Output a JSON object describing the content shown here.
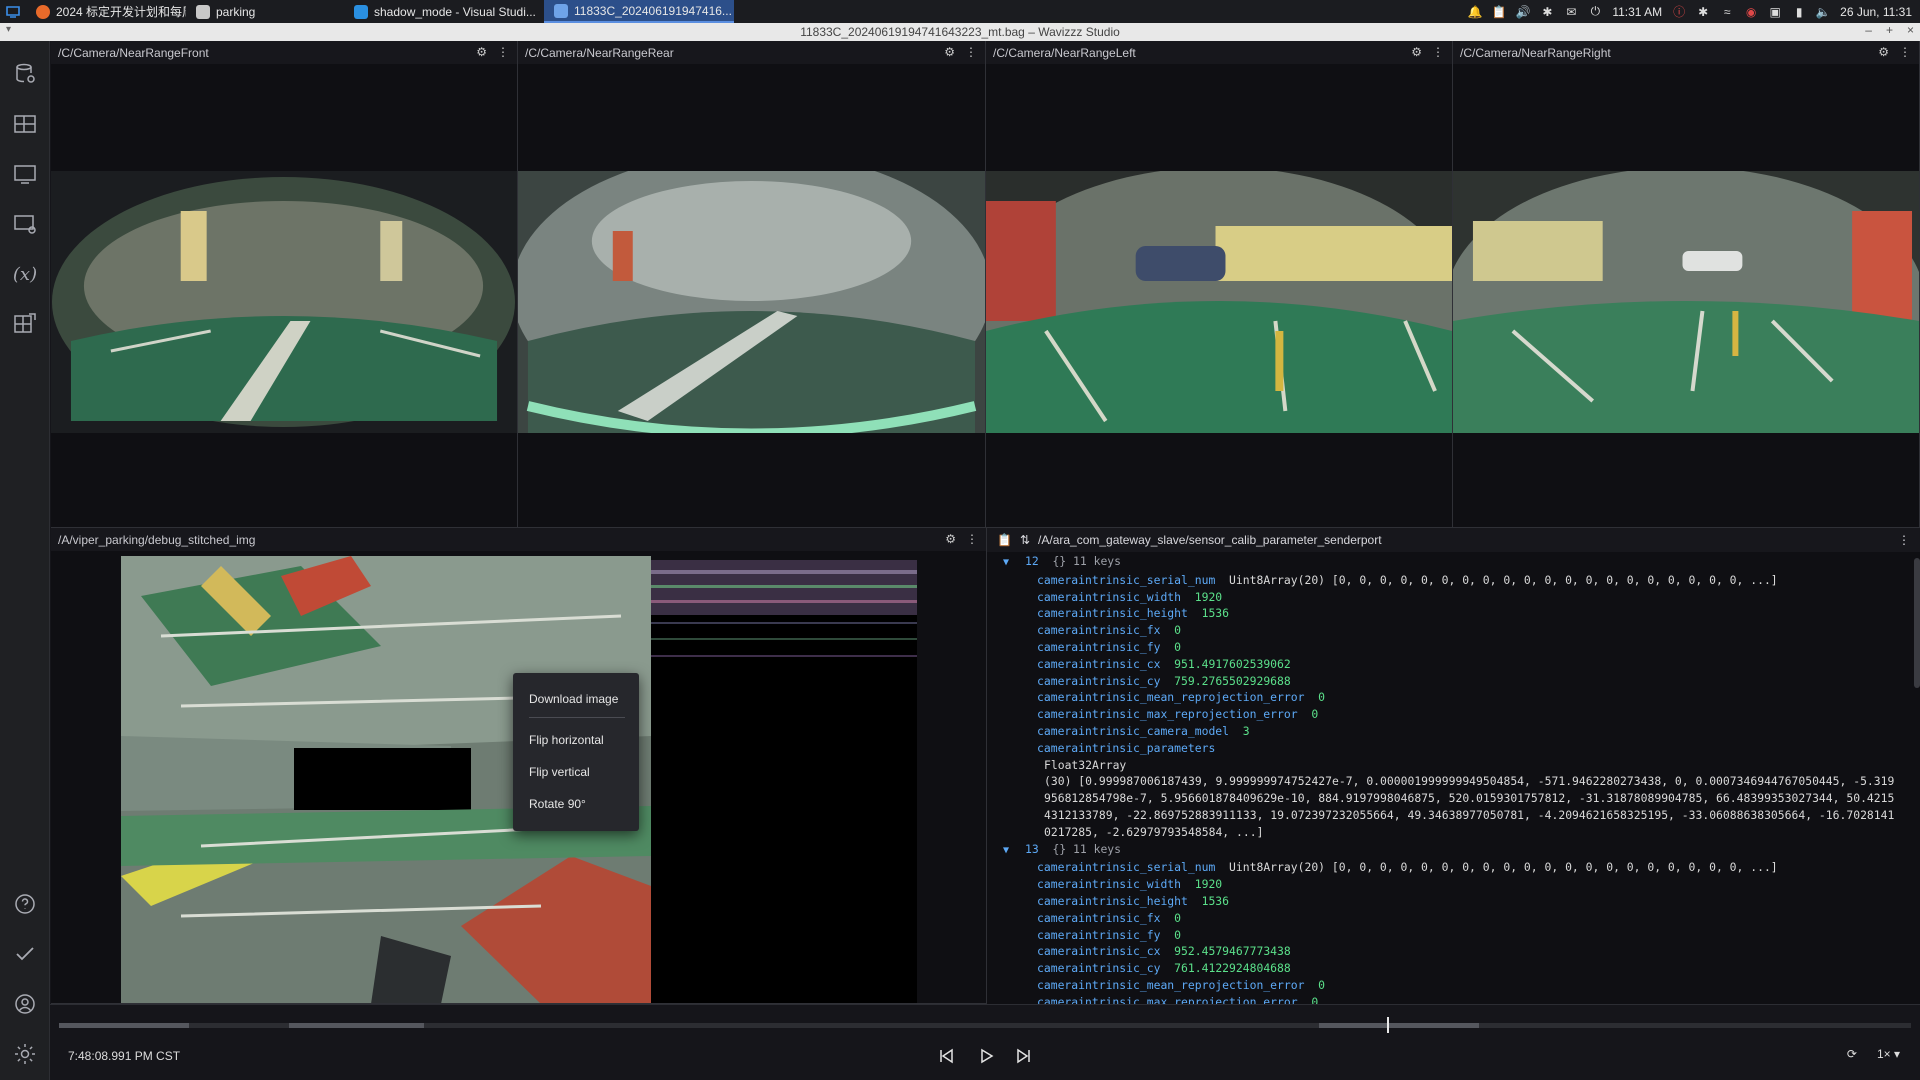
{
  "taskbar": {
    "tasks": [
      {
        "label": "2024 标定开发计划和每周进..."
      },
      {
        "label": "parking"
      },
      {
        "label": "shadow_mode - Visual Studi..."
      },
      {
        "label": "11833C_202406191947416..."
      }
    ],
    "clock": "11:31 AM",
    "date": "26 Jun, 11:31"
  },
  "window": {
    "title": "11833C_20240619194741643223_mt.bag – Wavizzz Studio",
    "controls": [
      "–",
      "+",
      "×"
    ]
  },
  "sidebar": {
    "icons": [
      "data-source-icon",
      "layout-icon",
      "panel-icon",
      "panel-settings-icon",
      "variables-icon",
      "extensions-icon",
      "help-icon",
      "check-icon",
      "account-icon",
      "settings-icon"
    ]
  },
  "panels": {
    "front": {
      "topic": "/C/Camera/NearRangeFront"
    },
    "rear": {
      "topic": "/C/Camera/NearRangeRear"
    },
    "left": {
      "topic": "/C/Camera/NearRangeLeft"
    },
    "right": {
      "topic": "/C/Camera/NearRangeRight"
    },
    "stitched": {
      "topic": "/A/viper_parking/debug_stitched_img"
    }
  },
  "context_menu": {
    "items": [
      "Download image",
      "Flip horizontal",
      "Flip vertical",
      "Rotate 90°"
    ]
  },
  "raw_messages": {
    "topic": "/A/ara_com_gateway_slave/sensor_calib_parameter_senderport",
    "entries": [
      {
        "index": "12",
        "summary": "{}  11 keys",
        "fields": [
          {
            "key": "cameraintrinsic_serial_num",
            "type": "Uint8Array(20)",
            "value": "[0, 0, 0, 0, 0, 0, 0, 0, 0, 0, 0, 0, 0, 0, 0, 0, 0, 0, 0, 0, ...]"
          },
          {
            "key": "cameraintrinsic_width",
            "value": "1920"
          },
          {
            "key": "cameraintrinsic_height",
            "value": "1536"
          },
          {
            "key": "cameraintrinsic_fx",
            "value": "0"
          },
          {
            "key": "cameraintrinsic_fy",
            "value": "0"
          },
          {
            "key": "cameraintrinsic_cx",
            "value": "951.4917602539062"
          },
          {
            "key": "cameraintrinsic_cy",
            "value": "759.2765502929688"
          },
          {
            "key": "cameraintrinsic_mean_reprojection_error",
            "value": "0"
          },
          {
            "key": "cameraintrinsic_max_reprojection_error",
            "value": "0"
          },
          {
            "key": "cameraintrinsic_camera_model",
            "value": "3"
          }
        ],
        "param_key": "cameraintrinsic_parameters",
        "param_type": "Float32Array",
        "param_value": "(30) [0.999987006187439, 9.999999974752427e-7, 0.000001999999949504854, -571.9462280273438, 0, 0.0007346944767050445, -5.319956812854798e-7, 5.956601878409629e-10, 884.9197998046875, 520.0159301757812, -31.31878089904785, 66.48399353027344, 50.42154312133789, -22.869752883911133, 19.072397232055664, 49.34638977050781, -4.2094621658325195, -33.06088638305664, -16.70281410217285, -2.62979793548584, ...]"
      },
      {
        "index": "13",
        "summary": "{}  11 keys",
        "fields": [
          {
            "key": "cameraintrinsic_serial_num",
            "type": "Uint8Array(20)",
            "value": "[0, 0, 0, 0, 0, 0, 0, 0, 0, 0, 0, 0, 0, 0, 0, 0, 0, 0, 0, 0, ...]"
          },
          {
            "key": "cameraintrinsic_width",
            "value": "1920"
          },
          {
            "key": "cameraintrinsic_height",
            "value": "1536"
          },
          {
            "key": "cameraintrinsic_fx",
            "value": "0"
          },
          {
            "key": "cameraintrinsic_fy",
            "value": "0"
          },
          {
            "key": "cameraintrinsic_cx",
            "value": "952.4579467773438"
          },
          {
            "key": "cameraintrinsic_cy",
            "value": "761.4122924804688"
          },
          {
            "key": "cameraintrinsic_mean_reprojection_error",
            "value": "0"
          },
          {
            "key": "cameraintrinsic_max_reprojection_error",
            "value": "0"
          }
        ]
      }
    ]
  },
  "playback": {
    "time": "7:48:08.991 PM CST",
    "speed": "1×"
  },
  "colors": {
    "accent": "#2c4f8a",
    "key": "#5da9f6",
    "value": "#5be08a",
    "background": "#0f0f13"
  }
}
